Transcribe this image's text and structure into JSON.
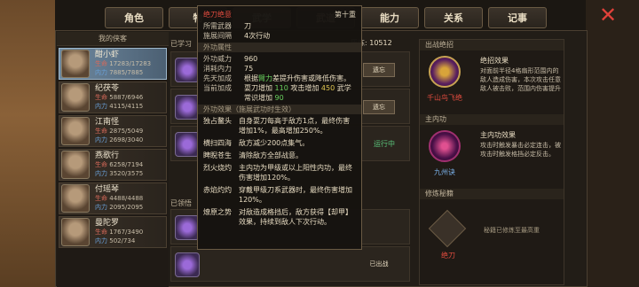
{
  "tabs": [
    {
      "label": "角色",
      "active": false
    },
    {
      "label": "物",
      "active": false
    },
    {
      "label": "武学",
      "active": true
    },
    {
      "label": "武道",
      "active": false
    },
    {
      "label": "能力",
      "active": false
    },
    {
      "label": "关系",
      "active": false
    },
    {
      "label": "记事",
      "active": false
    }
  ],
  "char_list": {
    "title": "我的侠客",
    "chars": [
      {
        "name": "酣小虾",
        "hp_label": "生命",
        "hp": "17283/17283",
        "mp_label": "内力",
        "mp": "7885/7885",
        "selected": true
      },
      {
        "name": "纪茯苓",
        "hp_label": "生命",
        "hp": "5887/6946",
        "mp_label": "内力",
        "mp": "4115/4115",
        "selected": false
      },
      {
        "name": "江南怪",
        "hp_label": "生命",
        "hp": "2875/5049",
        "mp_label": "内力",
        "mp": "2698/3040",
        "selected": false
      },
      {
        "name": "燕歌行",
        "hp_label": "生命",
        "hp": "6258/7194",
        "mp_label": "内力",
        "mp": "3520/3575",
        "selected": false
      },
      {
        "name": "付瑶琴",
        "hp_label": "生命",
        "hp": "4488/4488",
        "mp_label": "内力",
        "mp": "2095/2095",
        "selected": false
      },
      {
        "name": "曼陀罗",
        "hp_label": "生命",
        "hp": "1767/3490",
        "mp_label": "内力",
        "mp": "502/734",
        "selected": false
      }
    ]
  },
  "skill_area": {
    "learned_label": "已学习",
    "exp_label": "历练:",
    "exp_value": "10512",
    "buttons": [
      "遗忘",
      "遗忘",
      "运行中",
      "已出战"
    ],
    "other_label": "已领悟"
  },
  "tooltip": {
    "name": "绝刀绝意",
    "level": "第十重",
    "weapon_label": "所需武器",
    "weapon": "刀",
    "interval_label": "施展间隔",
    "interval": "4次行动",
    "sec_attr": "外功属性",
    "power_label": "外功威力",
    "power": "960",
    "cost_label": "消耗内力",
    "cost": "75",
    "innate_label": "先天加成",
    "innate_pre": "根据",
    "innate_hl": "臂力",
    "innate_post": "差提升伤害或降低伤害。",
    "current_label": "当前加成",
    "current_pre": "耍刀增加",
    "current_v1": "110",
    "current_mid": " 攻击增加",
    "current_v2": "450",
    "current_post": " 武学常识增加",
    "current_v3": "90",
    "sec_effect": "外功效果（施展武功时生效）",
    "effects": [
      {
        "name": "独占鳌头",
        "text": "自身耍刀每高于敌方1点，最终伤害增加1%，最高增加250%。"
      },
      {
        "name": "横扫四海",
        "text": "敌方减少200点集气。"
      },
      {
        "name": "睥睨苍生",
        "text": "清除敌方全部战意。"
      },
      {
        "name": "烈火烧灼",
        "text": "主内功为甲级或以上阳性内功，最终伤害增加120%。"
      },
      {
        "name": "赤焰灼灼",
        "text": "穿戴甲级刀系武器时，最终伤害增加120%。"
      },
      {
        "name": "燎原之势",
        "text": "对敌造成格挡后，敌方获得【却甲】效果，持续到敌人下次行动。"
      }
    ]
  },
  "right_col": {
    "sec1": "出战绝招",
    "ult_name": "千山鸟飞绝",
    "ult_title": "绝招效果",
    "ult_text": "对面前半径4格扇形范围内的敌人造成伤害，本次攻击任意敌人被击败，范围内伤害提升",
    "sec2": "主内功",
    "inner_name": "九州诀",
    "inner_title": "主内功效果",
    "inner_text": "攻击时触发暴击必定连击，被攻击时触发格挡必定反击。",
    "sec3": "修炼秘籍",
    "book_name": "绝刀",
    "book_text": "秘籍已修炼至最高重"
  },
  "colors": {
    "accent_red": "#e24c3f",
    "accent_green": "#69d35e",
    "accent_yellow": "#e0c650",
    "selected_bg": "#6f8aa1"
  },
  "icons": {
    "close": "close-icon"
  }
}
